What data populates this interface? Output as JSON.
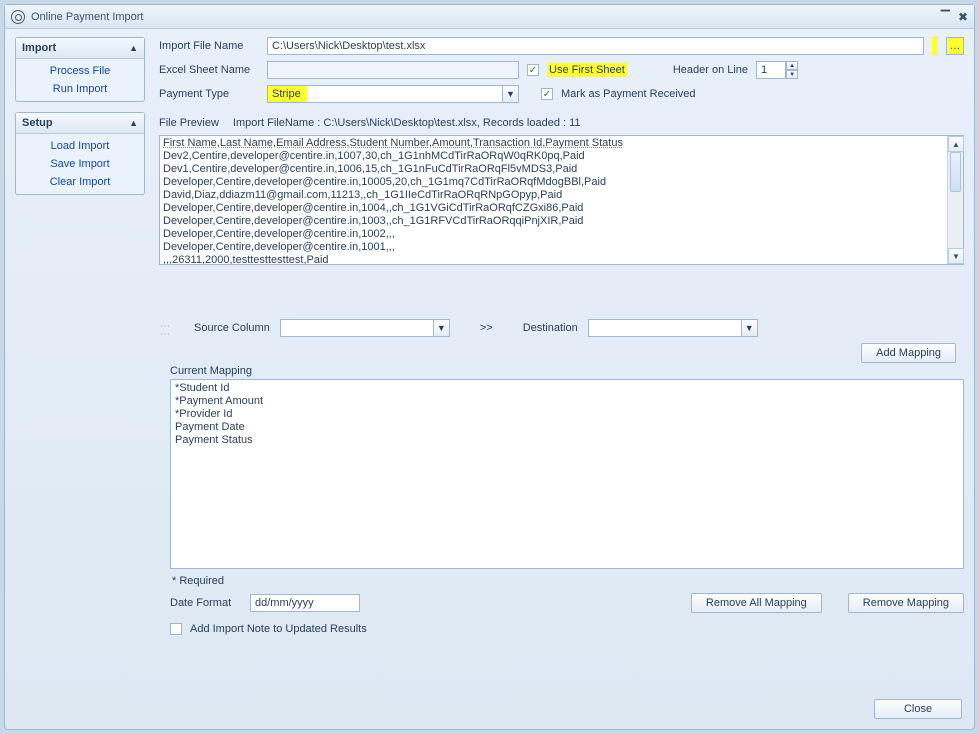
{
  "window": {
    "title": "Online Payment Import"
  },
  "sidebar": {
    "panels": [
      {
        "title": "Import",
        "links": [
          "Process File",
          "Run Import"
        ]
      },
      {
        "title": "Setup",
        "links": [
          "Load Import",
          "Save Import",
          "Clear Import"
        ]
      }
    ]
  },
  "form": {
    "importFileNameLabel": "Import File Name",
    "importFileName": "C:\\Users\\Nick\\Desktop\\test.xlsx",
    "excelSheetNameLabel": "Excel Sheet Name",
    "excelSheetName": "",
    "useFirstSheetLabel": "Use First Sheet",
    "useFirstSheetChecked": true,
    "headerOnLineLabel": "Header on Line",
    "headerOnLine": "1",
    "paymentTypeLabel": "Payment Type",
    "paymentType": "Stripe",
    "markAsPaymentReceivedLabel": "Mark as Payment Received",
    "markAsPaymentReceivedChecked": true
  },
  "preview": {
    "filePreviewLabel": "File Preview",
    "importFileNameInfo": "Import FileName : C:\\Users\\Nick\\Desktop\\test.xlsx, Records loaded : 11",
    "lines": [
      "First Name,Last Name,Email Address,Student Number,Amount,Transaction Id,Payment Status",
      "Dev2,Centire,developer@centire.in,1007,30,ch_1G1nhMCdTirRaORqW0qRK0pq,Paid",
      "Dev1,Centire,developer@centire.in,1006,15,ch_1G1nFuCdTirRaORqFl5vMDS3,Paid",
      "Developer,Centire,developer@centire.in,10005,20,ch_1G1mq7CdTirRaORqfMdogBBl,Paid",
      "David,Diaz,ddiazm11@gmail.com,11213,,ch_1G1IIeCdTirRaORqRNpGOpyp,Paid",
      "Developer,Centire,developer@centire.in,1004,,ch_1G1VGiCdTirRaORqfCZGxi86,Paid",
      "Developer,Centire,developer@centire.in,1003,,ch_1G1RFVCdTirRaORqqiPnjXIR,Paid",
      "Developer,Centire,developer@centire.in,1002,,,",
      "Developer,Centire,developer@centire.in,1001,,,",
      ",,,26311,2000,testtesttesttest,Paid"
    ]
  },
  "mapping": {
    "sourceColumnLabel": "Source Column",
    "destinationLabel": "Destination",
    "arrow": ">>",
    "addMappingLabel": "Add Mapping",
    "currentMappingLabel": "Current Mapping",
    "items": [
      "*Student Id",
      "*Payment Amount",
      "*Provider Id",
      "Payment Date",
      "Payment Status"
    ],
    "requiredNote": "*  Required",
    "dateFormatLabel": "Date Format",
    "dateFormat": "dd/mm/yyyy",
    "addImportNoteLabel": "Add Import Note to Updated Results",
    "removeAllMappingLabel": "Remove All Mapping",
    "removeMappingLabel": "Remove Mapping"
  },
  "buttons": {
    "close": "Close"
  }
}
